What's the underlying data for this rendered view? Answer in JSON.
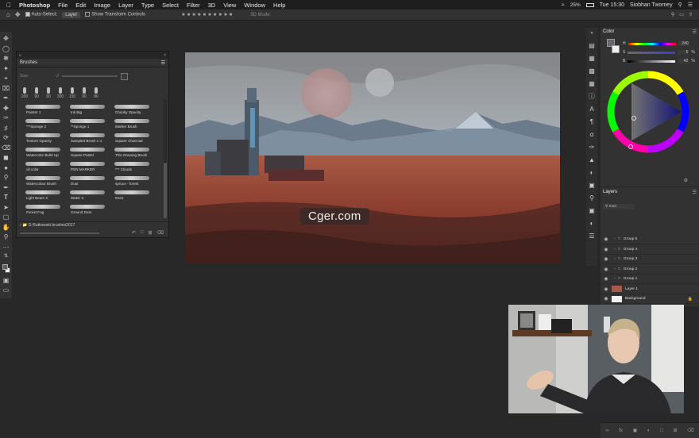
{
  "menubar": {
    "apple_icon": "apple-icon",
    "items": [
      "Photoshop",
      "File",
      "Edit",
      "Image",
      "Layer",
      "Type",
      "Select",
      "Filter",
      "3D",
      "View",
      "Window",
      "Help"
    ],
    "battery": "25%",
    "time": "Tue 15:30",
    "user": "Siobhan Twomey"
  },
  "options_bar": {
    "auto_select_label": "Auto-Select:",
    "auto_select_value": "Layer",
    "transform_label": "Show Transform Controls",
    "mode_label": "3D Mode:"
  },
  "brushes_panel": {
    "title": "Brushes",
    "size_label": "Size:",
    "tip_sizes": [
      "200",
      "90",
      "80",
      "300",
      "150",
      "90",
      "80"
    ],
    "brushes": [
      "Painter 1",
      "Ink Big",
      "Chunky Opacity",
      "***Sponge 2",
      "**Sponge 1",
      "Marker Brush",
      "Texture Opacity",
      "Sampled Brush 1 4",
      "Square Charcoal",
      "Watercolor Build Up",
      "Square Pastel",
      "Thin Drawing Brush",
      "oil color",
      "PEN MARKER",
      "*** Clouds",
      "Watercolour Brush",
      "Dust",
      "spruce - forest",
      "Light Beam 2",
      "Water 3",
      "tree1",
      "Forest Fog",
      "Ground Dust",
      ""
    ],
    "folder": "G-Rutkowski brushes2017"
  },
  "color_panel": {
    "title": "Color",
    "h_label": "H",
    "h_value": "240",
    "s_label": "S",
    "s_value": "5",
    "b_label": "B",
    "b_value": "42",
    "percent": "%"
  },
  "layers_panel": {
    "title": "Layers",
    "kind_label": "Kind",
    "layers": [
      "Group 5",
      "Group 4",
      "Group 3",
      "Group 2",
      "Group 1",
      "Layer 1",
      "Background"
    ]
  },
  "watermark": "Cger.com"
}
